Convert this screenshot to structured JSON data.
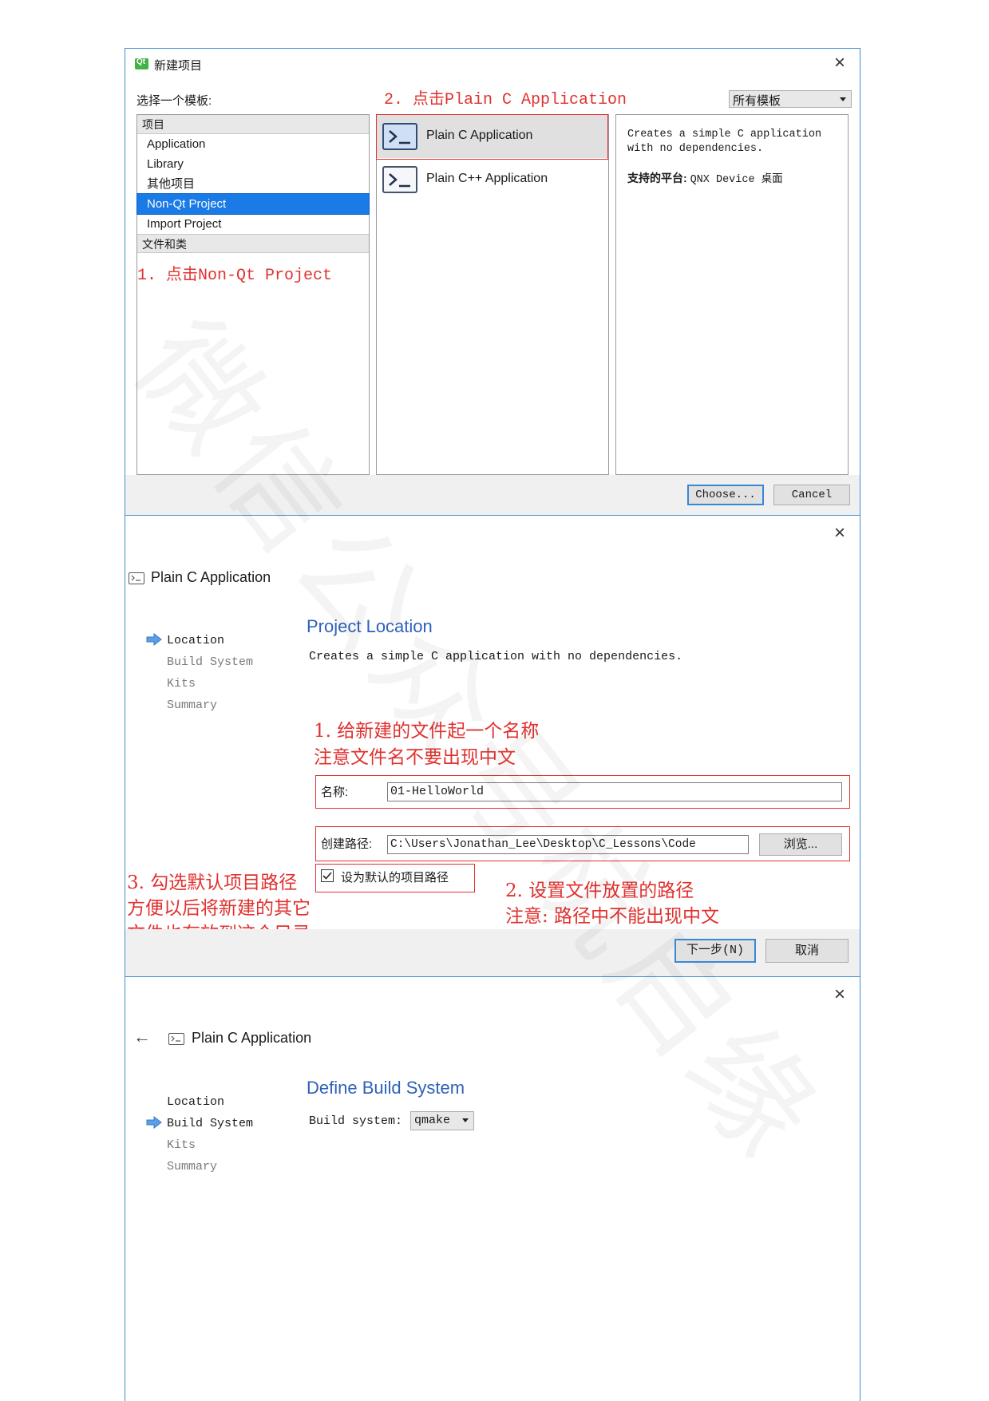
{
  "dialog1": {
    "title": "新建项目",
    "choose_template_label": "选择一个模板:",
    "filter_combo": "所有模板",
    "annotation_step2": "2. 点击Plain C Application",
    "annotation_step1": "1. 点击Non-Qt Project",
    "categories": {
      "header_project": "项目",
      "items": [
        "Application",
        "Library",
        "其他项目",
        "Non-Qt Project",
        "Import Project"
      ],
      "header_files": "文件和类"
    },
    "templates": [
      "Plain C Application",
      "Plain C++ Application"
    ],
    "description": {
      "text": "Creates a simple C application with no dependencies.",
      "platforms_label": "支持的平台:",
      "platforms_value": "QNX Device 桌面"
    },
    "choose_button": "Choose...",
    "cancel_button": "Cancel"
  },
  "dialog2": {
    "wizard_title": "Plain C Application",
    "steps": [
      "Location",
      "Build System",
      "Kits",
      "Summary"
    ],
    "page_title": "Project Location",
    "page_desc": "Creates a simple C application with no dependencies.",
    "annotation_name_line1": "1. 给新建的文件起一个名称",
    "annotation_name_line2": "注意文件名不要出现中文",
    "name_label": "名称:",
    "name_value": "01-HelloWorld",
    "path_label": "创建路径:",
    "path_value": "C:\\Users\\Jonathan_Lee\\Desktop\\C_Lessons\\Code",
    "browse_button": "浏览...",
    "default_path_checkbox": "设为默认的项目路径",
    "default_path_checked": true,
    "annotation_check_line1": "3. 勾选默认项目路径",
    "annotation_check_line2": "方便以后将新建的其它",
    "annotation_check_line3": "文件也存放到这个目录",
    "annotation_path_line1": "2. 设置文件放置的路径",
    "annotation_path_line2": "注意: 路径中不能出现中文",
    "next_button": "下一步(N)",
    "cancel_button": "取消"
  },
  "dialog3": {
    "wizard_title": "Plain C Application",
    "steps": [
      "Location",
      "Build System",
      "Kits",
      "Summary"
    ],
    "page_title": "Define Build System",
    "build_system_label": "Build system:",
    "build_system_value": "qmake"
  },
  "watermark": "微信公众号杭启缘",
  "colors": {
    "accent": "#3c8fd0",
    "selection": "#1a7ae6",
    "annotation": "#e0322f",
    "page_title": "#2e62b8"
  }
}
